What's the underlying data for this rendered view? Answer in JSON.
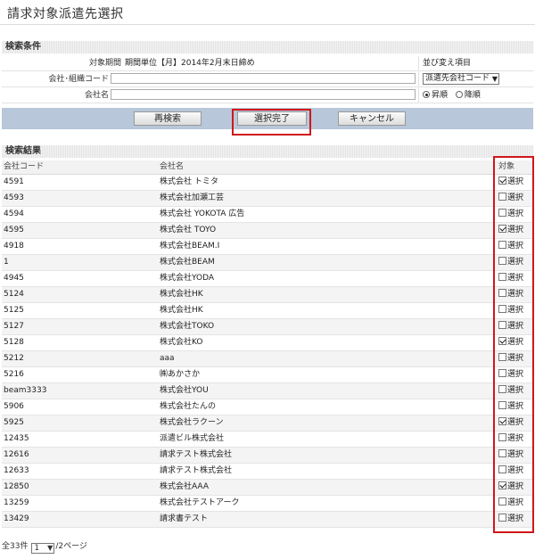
{
  "page": {
    "title": "請求対象派遣先選択"
  },
  "search": {
    "header": "検索条件",
    "period_label": "対象期間",
    "period_value": "期間単位【月】2014年2月末日締め",
    "company_code_label": "会社･組織コード",
    "company_code_value": "",
    "company_name_label": "会社名",
    "company_name_value": "",
    "sort_label": "並び変え項目",
    "sort_value": "派遣先会社コード",
    "sort_asc_label": "昇順",
    "sort_desc_label": "降順",
    "sort_order": "asc"
  },
  "buttons": {
    "research": "再検索",
    "select_done": "選択完了",
    "cancel": "キャンセル"
  },
  "results": {
    "header": "検索結果",
    "columns": {
      "code": "会社コード",
      "name": "会社名",
      "target": "対象"
    },
    "select_label": "選択",
    "rows": [
      {
        "code": "4591",
        "name": "株式会社 トミタ",
        "checked": true
      },
      {
        "code": "4593",
        "name": "株式会社加瀬工芸",
        "checked": false
      },
      {
        "code": "4594",
        "name": "株式会社 YOKOTA 広告",
        "checked": false
      },
      {
        "code": "4595",
        "name": "株式会社 TOYO",
        "checked": true
      },
      {
        "code": "4918",
        "name": "株式会社BEAM.I",
        "checked": false
      },
      {
        "code": "1",
        "name": "株式会社BEAM",
        "checked": false
      },
      {
        "code": "4945",
        "name": "株式会社YODA",
        "checked": false
      },
      {
        "code": "5124",
        "name": "株式会社HK",
        "checked": false
      },
      {
        "code": "5125",
        "name": "株式会社HK",
        "checked": false
      },
      {
        "code": "5127",
        "name": "株式会社TOKO",
        "checked": false
      },
      {
        "code": "5128",
        "name": "株式会社KO",
        "checked": true
      },
      {
        "code": "5212",
        "name": "aaa",
        "checked": false
      },
      {
        "code": "5216",
        "name": "㈱あかさか",
        "checked": false
      },
      {
        "code": "beam3333",
        "name": "株式会社YOU",
        "checked": false
      },
      {
        "code": "5906",
        "name": "株式会社たんの",
        "checked": false
      },
      {
        "code": "5925",
        "name": "株式会社ラクーン",
        "checked": true
      },
      {
        "code": "12435",
        "name": "派遣ビル株式会社",
        "checked": false
      },
      {
        "code": "12616",
        "name": "請求テスト株式会社",
        "checked": false
      },
      {
        "code": "12633",
        "name": "請求テスト株式会社",
        "checked": false
      },
      {
        "code": "12850",
        "name": "株式会社AAA",
        "checked": true
      },
      {
        "code": "13259",
        "name": "株式会社テストアーク",
        "checked": false
      },
      {
        "code": "13429",
        "name": "請求書テスト",
        "checked": false
      }
    ]
  },
  "footer": {
    "total": "全33件",
    "page_value": "1",
    "pages_suffix": "/2ページ"
  },
  "colors": {
    "highlight": "#d0171c",
    "button_bar": "#b8c7d9"
  }
}
